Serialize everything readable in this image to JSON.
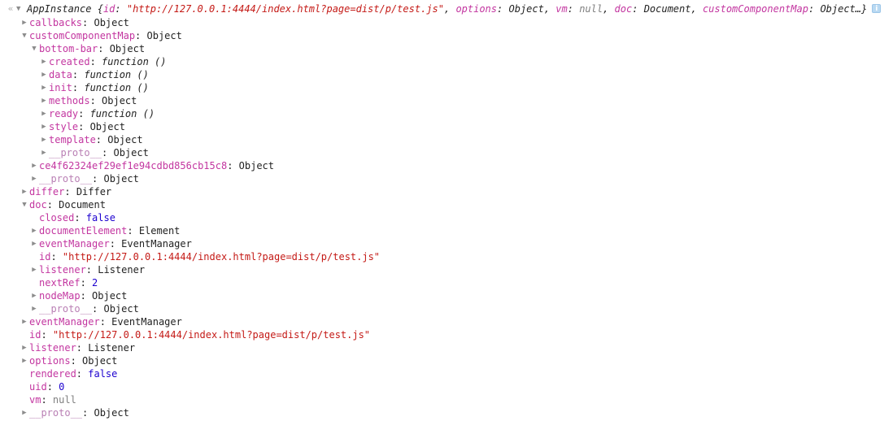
{
  "header": {
    "nav_chevron": "«",
    "twisty": "▼",
    "constructor": "AppInstance",
    "open_brace": " {",
    "close_brace": "…}",
    "info_badge": "i",
    "parts": [
      {
        "key": "id",
        "value": "\"http://127.0.0.1:4444/index.html?page=dist/p/test.js\"",
        "type": "string"
      },
      {
        "key": "options",
        "value": "Object",
        "type": "object"
      },
      {
        "key": "vm",
        "value": "null",
        "type": "null"
      },
      {
        "key": "doc",
        "value": "Document",
        "type": "object"
      },
      {
        "key": "customComponentMap",
        "value": "Object",
        "type": "object"
      }
    ]
  },
  "icons": {
    "collapsed": "▶",
    "expanded": "▼"
  },
  "tree": [
    {
      "depth": 1,
      "state": "collapsed",
      "name": "callbacks",
      "value": "Object",
      "type": "object"
    },
    {
      "depth": 1,
      "state": "expanded",
      "name": "customComponentMap",
      "value": "Object",
      "type": "object"
    },
    {
      "depth": 2,
      "state": "expanded",
      "name": "bottom-bar",
      "value": "Object",
      "type": "object"
    },
    {
      "depth": 3,
      "state": "collapsed",
      "name": "created",
      "value": "function ()",
      "type": "function"
    },
    {
      "depth": 3,
      "state": "collapsed",
      "name": "data",
      "value": "function ()",
      "type": "function"
    },
    {
      "depth": 3,
      "state": "collapsed",
      "name": "init",
      "value": "function ()",
      "type": "function"
    },
    {
      "depth": 3,
      "state": "collapsed",
      "name": "methods",
      "value": "Object",
      "type": "object"
    },
    {
      "depth": 3,
      "state": "collapsed",
      "name": "ready",
      "value": "function ()",
      "type": "function"
    },
    {
      "depth": 3,
      "state": "collapsed",
      "name": "style",
      "value": "Object",
      "type": "object"
    },
    {
      "depth": 3,
      "state": "collapsed",
      "name": "template",
      "value": "Object",
      "type": "object"
    },
    {
      "depth": 3,
      "state": "collapsed",
      "name": "__proto__",
      "value": "Object",
      "type": "object",
      "proto": true
    },
    {
      "depth": 2,
      "state": "collapsed",
      "name": "ce4f62324ef29ef1e94cdbd856cb15c8",
      "value": "Object",
      "type": "object"
    },
    {
      "depth": 2,
      "state": "collapsed",
      "name": "__proto__",
      "value": "Object",
      "type": "object",
      "proto": true
    },
    {
      "depth": 1,
      "state": "collapsed",
      "name": "differ",
      "value": "Differ",
      "type": "object"
    },
    {
      "depth": 1,
      "state": "expanded",
      "name": "doc",
      "value": "Document",
      "type": "object"
    },
    {
      "depth": 2,
      "state": "leaf",
      "name": "closed",
      "value": "false",
      "type": "boolean"
    },
    {
      "depth": 2,
      "state": "collapsed",
      "name": "documentElement",
      "value": "Element",
      "type": "object"
    },
    {
      "depth": 2,
      "state": "collapsed",
      "name": "eventManager",
      "value": "EventManager",
      "type": "object"
    },
    {
      "depth": 2,
      "state": "leaf",
      "name": "id",
      "value": "\"http://127.0.0.1:4444/index.html?page=dist/p/test.js\"",
      "type": "string"
    },
    {
      "depth": 2,
      "state": "collapsed",
      "name": "listener",
      "value": "Listener",
      "type": "object"
    },
    {
      "depth": 2,
      "state": "leaf",
      "name": "nextRef",
      "value": "2",
      "type": "number"
    },
    {
      "depth": 2,
      "state": "collapsed",
      "name": "nodeMap",
      "value": "Object",
      "type": "object"
    },
    {
      "depth": 2,
      "state": "collapsed",
      "name": "__proto__",
      "value": "Object",
      "type": "object",
      "proto": true
    },
    {
      "depth": 1,
      "state": "collapsed",
      "name": "eventManager",
      "value": "EventManager",
      "type": "object"
    },
    {
      "depth": 1,
      "state": "leaf",
      "name": "id",
      "value": "\"http://127.0.0.1:4444/index.html?page=dist/p/test.js\"",
      "type": "string"
    },
    {
      "depth": 1,
      "state": "collapsed",
      "name": "listener",
      "value": "Listener",
      "type": "object"
    },
    {
      "depth": 1,
      "state": "collapsed",
      "name": "options",
      "value": "Object",
      "type": "object"
    },
    {
      "depth": 1,
      "state": "leaf",
      "name": "rendered",
      "value": "false",
      "type": "boolean"
    },
    {
      "depth": 1,
      "state": "leaf",
      "name": "uid",
      "value": "0",
      "type": "number"
    },
    {
      "depth": 1,
      "state": "leaf",
      "name": "vm",
      "value": "null",
      "type": "null"
    },
    {
      "depth": 1,
      "state": "collapsed",
      "name": "__proto__",
      "value": "Object",
      "type": "object",
      "proto": true
    }
  ]
}
